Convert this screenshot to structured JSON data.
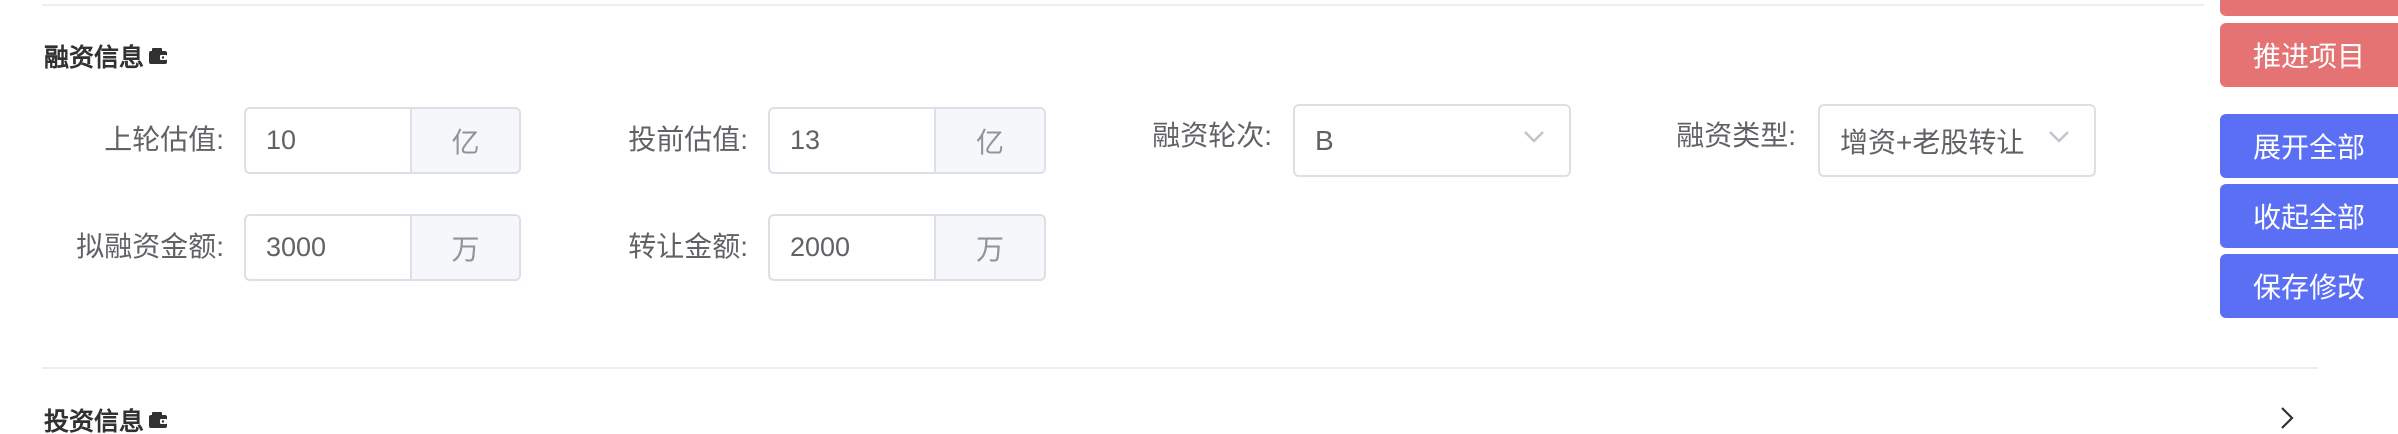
{
  "financing": {
    "title": "融资信息",
    "fields": {
      "prev_valuation": {
        "label": "上轮估值:",
        "value": "10",
        "unit": "亿"
      },
      "pre_money": {
        "label": "投前估值:",
        "value": "13",
        "unit": "亿"
      },
      "round": {
        "label": "融资轮次:",
        "value": "B"
      },
      "type": {
        "label": "融资类型:",
        "value": "增资+老股转让"
      },
      "amount": {
        "label": "拟融资金额:",
        "value": "3000",
        "unit": "万"
      },
      "transfer": {
        "label": "转让金额:",
        "value": "2000",
        "unit": "万"
      }
    }
  },
  "investment": {
    "title": "投资信息"
  },
  "side_actions": {
    "advance": "推进项目",
    "expand_all": "展开全部",
    "collapse_all": "收起全部",
    "save": "保存修改"
  },
  "colors": {
    "red_button": "#e57373",
    "blue_button": "#5b6ff5"
  }
}
